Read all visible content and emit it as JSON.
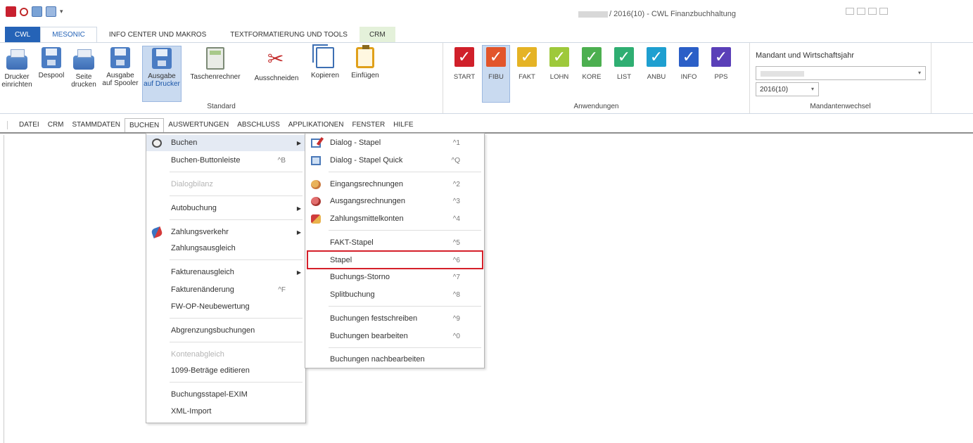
{
  "window": {
    "title": "/ 2016(10) - CWL Finanzbuchhaltung"
  },
  "tabs": [
    {
      "label": "CWL"
    },
    {
      "label": "MESONIC"
    },
    {
      "label": "INFO CENTER UND MAKROS"
    },
    {
      "label": "TEXTFORMATIERUNG UND TOOLS"
    },
    {
      "label": "CRM"
    }
  ],
  "ribbon": {
    "standard": {
      "label": "Standard",
      "buttons": [
        {
          "line1": "Drucker",
          "line2": "einrichten"
        },
        {
          "line1": "Despool",
          "line2": ""
        },
        {
          "line1": "Seite",
          "line2": "drucken"
        },
        {
          "line1": "Ausgabe",
          "line2": "auf Spooler"
        },
        {
          "line1": "Ausgabe",
          "line2": "auf Drucker"
        },
        {
          "line1": "Taschenrechner",
          "line2": ""
        },
        {
          "line1": "Ausschneiden",
          "line2": ""
        },
        {
          "line1": "Kopieren",
          "line2": ""
        },
        {
          "line1": "Einfügen",
          "line2": ""
        }
      ]
    },
    "anwendungen": {
      "label": "Anwendungen",
      "apps": [
        {
          "label": "START",
          "color": "#d0202a",
          "num": ""
        },
        {
          "label": "FIBU",
          "color": "#e2552a",
          "num": "1"
        },
        {
          "label": "FAKT",
          "color": "#e5b325",
          "num": "2"
        },
        {
          "label": "LOHN",
          "color": "#9ec93b",
          "num": "3"
        },
        {
          "label": "KORE",
          "color": "#4caf50",
          "num": "4"
        },
        {
          "label": "LIST",
          "color": "#2fae72",
          "num": "5"
        },
        {
          "label": "ANBU",
          "color": "#1e9fd0",
          "num": "6"
        },
        {
          "label": "INFO",
          "color": "#2b5fc7",
          "num": "7"
        },
        {
          "label": "PPS",
          "color": "#5a3fb8",
          "num": "8"
        }
      ]
    },
    "mandant": {
      "title": "Mandant und Wirtschaftsjahr",
      "year": "2016(10)",
      "label": "Mandantenwechsel"
    }
  },
  "menubar": [
    {
      "label": "DATEI"
    },
    {
      "label": "CRM"
    },
    {
      "label": "STAMMDATEN"
    },
    {
      "label": "BUCHEN"
    },
    {
      "label": "AUSWERTUNGEN"
    },
    {
      "label": "ABSCHLUSS"
    },
    {
      "label": "APPLIKATIONEN"
    },
    {
      "label": "FENSTER"
    },
    {
      "label": "HILFE"
    }
  ],
  "menu1": {
    "buchen": {
      "label": "Buchen"
    },
    "buttonleiste": {
      "label": "Buchen-Buttonleiste",
      "shortcut": "^B"
    },
    "dialogbilanz": {
      "label": "Dialogbilanz"
    },
    "autobuchung": {
      "label": "Autobuchung"
    },
    "zahlungsverkehr": {
      "label": "Zahlungsverkehr"
    },
    "zahlungsausgleich": {
      "label": "Zahlungsausgleich"
    },
    "fakturenausgleich": {
      "label": "Fakturenausgleich"
    },
    "fakturenaenderung": {
      "label": "Fakturenänderung",
      "shortcut": "^F"
    },
    "fwop": {
      "label": "FW-OP-Neubewertung"
    },
    "abgrenzung": {
      "label": "Abgrenzungsbuchungen"
    },
    "kontenabgleich": {
      "label": "Kontenabgleich"
    },
    "betraege1099": {
      "label": "1099-Beträge editieren"
    },
    "exim": {
      "label": "Buchungsstapel-EXIM"
    },
    "xml": {
      "label": "XML-Import"
    }
  },
  "menu2": {
    "dialog_stapel": {
      "label": "Dialog - Stapel",
      "shortcut": "^1"
    },
    "dialog_stapel_quick": {
      "label": "Dialog - Stapel Quick",
      "shortcut": "^Q"
    },
    "eingang": {
      "label": "Eingangsrechnungen",
      "shortcut": "^2"
    },
    "ausgang": {
      "label": "Ausgangsrechnungen",
      "shortcut": "^3"
    },
    "zahlungsmittel": {
      "label": "Zahlungsmittelkonten",
      "shortcut": "^4"
    },
    "fakt_stapel": {
      "label": "FAKT-Stapel",
      "shortcut": "^5"
    },
    "stapel": {
      "label": "Stapel",
      "shortcut": "^6"
    },
    "storno": {
      "label": "Buchungs-Storno",
      "shortcut": "^7"
    },
    "split": {
      "label": "Splitbuchung",
      "shortcut": "^8"
    },
    "festschreiben": {
      "label": "Buchungen festschreiben",
      "shortcut": "^9"
    },
    "bearbeiten": {
      "label": "Buchungen bearbeiten",
      "shortcut": "^0"
    },
    "nachbearbeiten": {
      "label": "Buchungen nachbearbeiten"
    }
  }
}
